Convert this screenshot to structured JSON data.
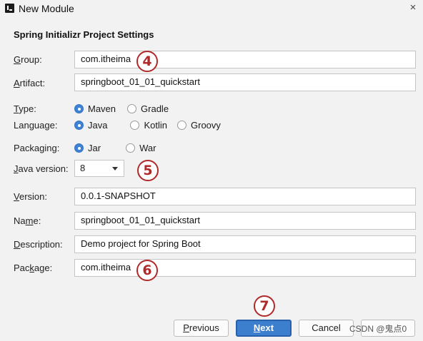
{
  "window": {
    "title": "New Module",
    "close_glyph": "×",
    "app_icon": "intellij-idea-icon"
  },
  "section_title": "Spring Initializr Project Settings",
  "form": {
    "group": {
      "label_underlined": "G",
      "label_rest": "roup:",
      "value": "com.itheima"
    },
    "artifact": {
      "label_underlined": "A",
      "label_rest": "rtifact:",
      "value": "springboot_01_01_quickstart"
    },
    "type": {
      "label_underlined": "T",
      "label_rest": "ype:",
      "options": [
        "Maven",
        "Gradle"
      ],
      "selected": "Maven"
    },
    "language": {
      "label": "Language:",
      "options": [
        "Java",
        "Kotlin",
        "Groovy"
      ],
      "selected": "Java"
    },
    "packaging": {
      "label": "Packaging:",
      "options": [
        "Jar",
        "War"
      ],
      "selected": "Jar"
    },
    "java_version": {
      "label_underlined": "J",
      "label_rest": "ava version:",
      "value": "8"
    },
    "version": {
      "label_underlined": "V",
      "label_rest": "ersion:",
      "value": "0.0.1-SNAPSHOT"
    },
    "name": {
      "label_prefix": "Na",
      "label_underlined": "m",
      "label_rest": "e:",
      "value": "springboot_01_01_quickstart"
    },
    "description": {
      "label_underlined": "D",
      "label_rest": "escription:",
      "value": "Demo project for Spring Boot"
    },
    "package": {
      "label_prefix": "Pac",
      "label_underlined": "k",
      "label_rest": "age:",
      "value": "com.itheima"
    }
  },
  "annotations": {
    "marker_4": "4",
    "marker_5": "5",
    "marker_6": "6",
    "marker_7": "7"
  },
  "buttons": {
    "previous": {
      "underlined": "P",
      "rest": "revious"
    },
    "next": {
      "underlined": "N",
      "rest": "ext"
    },
    "cancel": "Cancel"
  },
  "watermark": "CSDN @鬼点0",
  "colors": {
    "accent": "#3b7fce",
    "annotation": "#b02a2a"
  }
}
